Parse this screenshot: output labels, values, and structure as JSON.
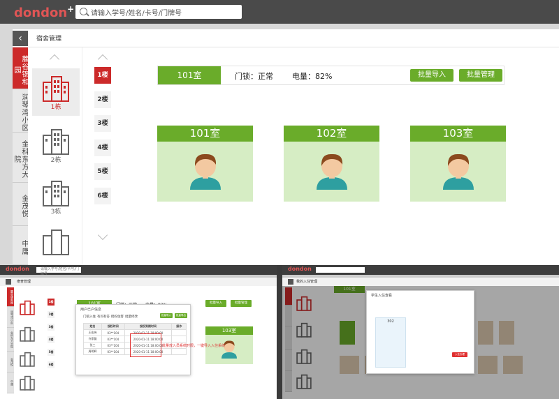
{
  "app": {
    "logo_text": "dondon",
    "logo_plus": "+"
  },
  "search": {
    "placeholder": "请输入学号/姓名/卡号/门牌号"
  },
  "page": {
    "title": "宿舍管理",
    "back": "‹"
  },
  "communities": [
    {
      "label": "麓谷锦和园",
      "active": true
    },
    {
      "label": "润琴湾小区",
      "active": false
    },
    {
      "label": "金科东方大院",
      "active": false
    },
    {
      "label": "金茂悦",
      "active": false
    },
    {
      "label": "中庸",
      "active": false
    }
  ],
  "buildings": [
    {
      "label": "1栋",
      "active": true
    },
    {
      "label": "2栋",
      "active": false
    },
    {
      "label": "3栋",
      "active": false
    },
    {
      "label": "",
      "active": false
    }
  ],
  "floors": [
    {
      "label": "1楼",
      "active": true
    },
    {
      "label": "2楼",
      "active": false
    },
    {
      "label": "3楼",
      "active": false
    },
    {
      "label": "4楼",
      "active": false
    },
    {
      "label": "5楼",
      "active": false
    },
    {
      "label": "6楼",
      "active": false
    }
  ],
  "info_bar": {
    "room": "101室",
    "lock": "门锁：正常",
    "power": "电量：82%",
    "import_btn": "批量导入",
    "manage_btn": "批量管理"
  },
  "rooms": [
    {
      "label": "101室"
    },
    {
      "label": "102室"
    },
    {
      "label": "103室"
    }
  ],
  "colors": {
    "accent_green": "#6aac2a",
    "active_red": "#cc2a2a",
    "room_bg": "#d6edc4"
  },
  "panel_left": {
    "logo_text": "dondon",
    "search": "请输入学号/姓名/卡号/门牌号",
    "title": "宿舍管理",
    "communities": [
      "麓谷锦和园",
      "润琴湾小区",
      "金科东方大院",
      "金茂悦",
      "中庸"
    ],
    "floors": [
      "1楼",
      "2楼",
      "3楼",
      "4楼",
      "5楼",
      "6楼"
    ],
    "info_room": "101室",
    "info_lock": "门锁：正常",
    "info_power": "电量：82%",
    "import_btn": "批量导入",
    "manage_btn": "批量管理",
    "dialog_title": "用户已户信息",
    "tabs": [
      "门锁入住",
      "有问有答",
      "授权住客",
      "批量修改"
    ],
    "dialog_btn_1": "批量导入",
    "dialog_btn_2": "批量导出",
    "table_headers": [
      "姓名",
      "授权时间",
      "授权到期时间",
      "操作"
    ],
    "table_rows": [
      [
        "王宏伟",
        "03**104",
        "2020-01-11 18:00:00",
        ""
      ],
      [
        "许家磊",
        "03**104",
        "2020-01-11 18:00:00",
        ""
      ],
      [
        "张三",
        "03**104",
        "2020-01-11 18:00:00",
        ""
      ],
      [
        "周明辉",
        "03**104",
        "2020-01-11 18:00:00",
        ""
      ]
    ],
    "annotation": "批量放入员系统时限，一键导入入住系统",
    "room_card": "103室"
  },
  "panel_right": {
    "logo_text": "dondon",
    "title": "我的入住管理",
    "room_tag": "101室",
    "dialog_title": "学生入住查看",
    "dialog_room": "302",
    "dialog_btn": "入住办理"
  }
}
